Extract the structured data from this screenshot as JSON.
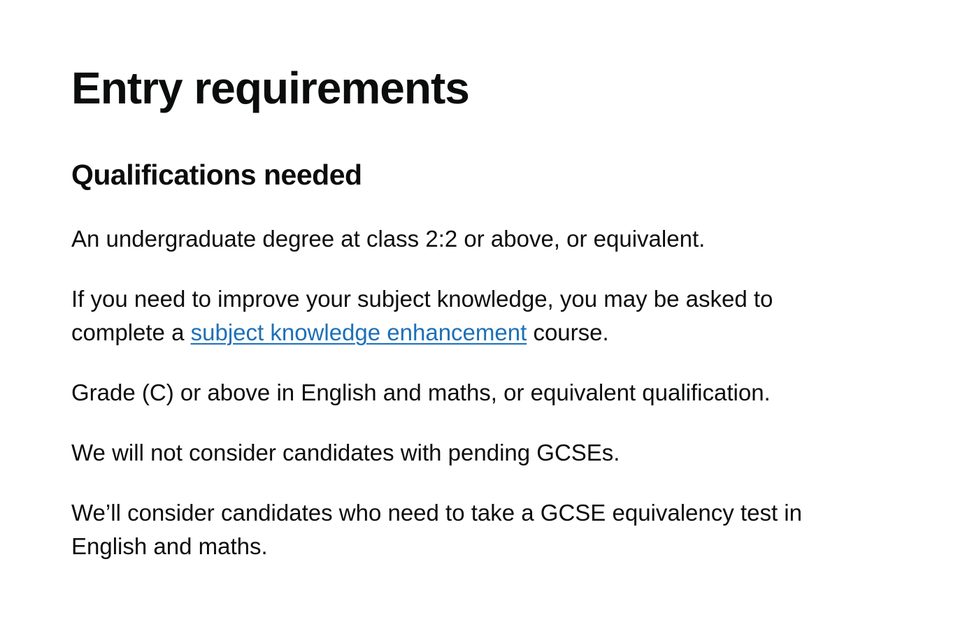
{
  "page": {
    "title": "Entry requirements"
  },
  "qualifications": {
    "heading": "Qualifications needed",
    "degree": "An undergraduate degree at class 2:2 or above, or equivalent.",
    "ske_prefix": "If you need to improve your subject knowledge, you may be asked to complete a",
    "ske_link": "subject knowledge enhancement",
    "ske_suffix": "course.",
    "gcse_grade": "Grade (C) or above in English and maths, or equivalent qualification.",
    "pending_gcse": "We will not consider candidates with pending GCSEs.",
    "equivalency": "We’ll consider candidates who need to take a GCSE equivalency test in English and maths."
  },
  "colors": {
    "text": "#0b0c0c",
    "link": "#1d70b8",
    "background": "#ffffff"
  }
}
